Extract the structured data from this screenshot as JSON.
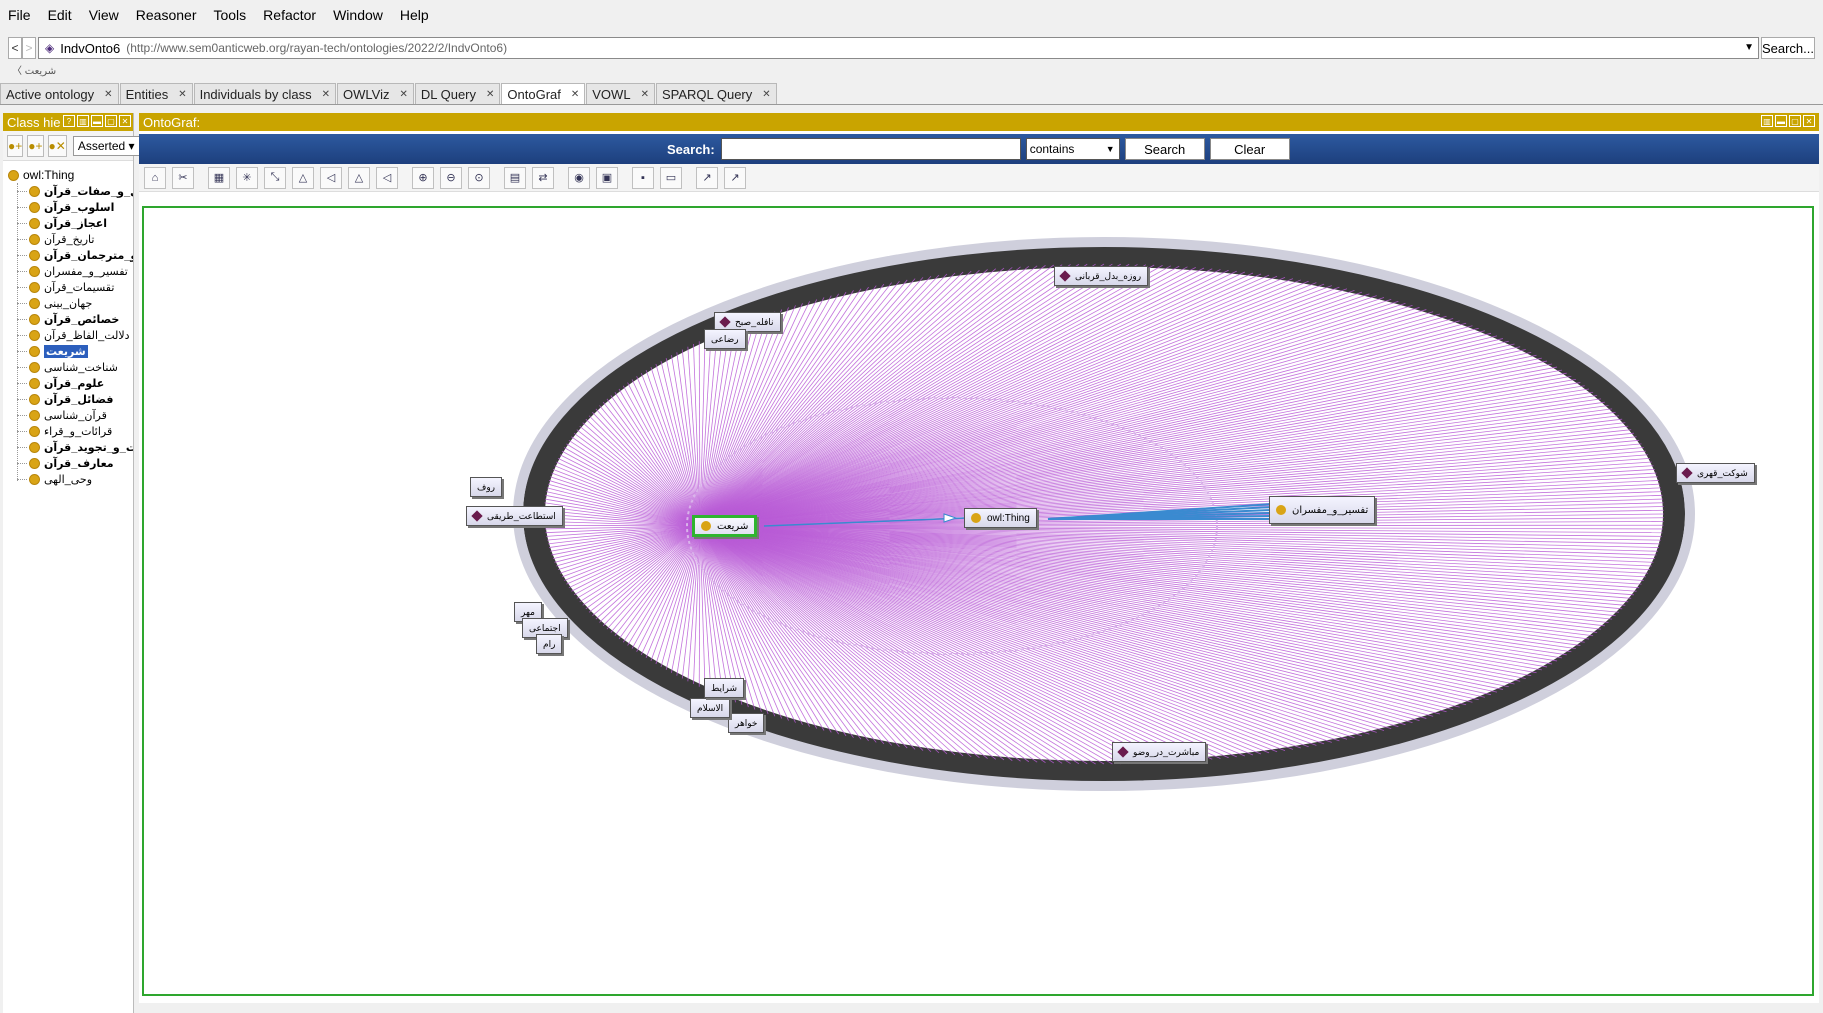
{
  "menu": [
    "File",
    "Edit",
    "View",
    "Reasoner",
    "Tools",
    "Refactor",
    "Window",
    "Help"
  ],
  "address": {
    "back": "<",
    "forward": ">",
    "ontology_name": "IndvOnto6",
    "iri": "(http://www.sem0anticweb.org/rayan-tech/ontologies/2022/2/IndvOnto6)",
    "search_button": "Search..."
  },
  "breadcrumb": "شریعت",
  "tabs": [
    {
      "label": "Active ontology",
      "active": false
    },
    {
      "label": "Entities",
      "active": false
    },
    {
      "label": "Individuals by class",
      "active": false
    },
    {
      "label": "OWLViz",
      "active": false
    },
    {
      "label": "DL Query",
      "active": false
    },
    {
      "label": "OntoGraf",
      "active": true
    },
    {
      "label": "VOWL",
      "active": false
    },
    {
      "label": "SPARQL Query",
      "active": false
    }
  ],
  "class_panel": {
    "title": "Class hie",
    "mode": "Asserted",
    "root": "owl:Thing",
    "items": [
      {
        "label": "اسامی_و_صفات_قرآن",
        "bold": true
      },
      {
        "label": "اسلوب_قرآن",
        "bold": true
      },
      {
        "label": "اعجاز_قرآن",
        "bold": true
      },
      {
        "label": "تاریخ_قرآن",
        "bold": false
      },
      {
        "label": "ترجمه_و_مترجمان_قرآن",
        "bold": true
      },
      {
        "label": "تفسیر_و_مفسران",
        "bold": false
      },
      {
        "label": "تقسیمات_قرآن",
        "bold": false
      },
      {
        "label": "جهان_بینی",
        "bold": false
      },
      {
        "label": "خصائص_قرآن",
        "bold": true
      },
      {
        "label": "دلالت_الفاظ_قرآن",
        "bold": false
      },
      {
        "label": "شریعت",
        "bold": true,
        "selected": true
      },
      {
        "label": "شناخت_شناسی",
        "bold": false
      },
      {
        "label": "علوم_قرآن",
        "bold": true
      },
      {
        "label": "فضائل_قرآن",
        "bold": true
      },
      {
        "label": "قرآن_شناسی",
        "bold": false
      },
      {
        "label": "قرائات_و_قراء",
        "bold": false
      },
      {
        "label": "قرائت_و_تجوید_قرآن",
        "bold": true
      },
      {
        "label": "معارف_قرآن",
        "bold": true
      },
      {
        "label": "وحی_الهی",
        "bold": false
      }
    ]
  },
  "ontograf": {
    "title": "OntoGraf:",
    "search_label": "Search:",
    "search_value": "",
    "match_mode": "contains",
    "search_button": "Search",
    "clear_button": "Clear",
    "toolbar_icons": [
      "home-icon",
      "remove-icon",
      "grid-layout-icon",
      "radial-layout-icon",
      "spring-layout-icon",
      "tree-vertical-icon",
      "tree-horizontal-icon",
      "vertical-directed-icon",
      "horizontal-directed-icon",
      "zoom-in-icon",
      "zoom-out-icon",
      "zoom-fit-icon",
      "filter-nodes-icon",
      "filter-arcs-icon",
      "snapshot-icon",
      "export-image-icon",
      "save-icon",
      "open-icon",
      "export-dot-icon",
      "export-image2-icon"
    ],
    "colors": {
      "individual_arc": "#b85ad6",
      "subclass_arc": "#3a8ad0",
      "focus_border": "#2fb52f",
      "class_dot": "#d9a416",
      "individual_diamond": "#6a1b4d"
    },
    "focus_node": "شریعت",
    "root_node": "owl:Thing",
    "sibling_node": "تفسیر_و_مفسران",
    "visible_individuals": [
      "روزه_بدل_قربانی",
      "نافله_صبح",
      "رضاعی",
      "شوکت_قهری",
      "استطاعت_طریقی",
      "مباشرت_در_وضو",
      "روف",
      "مهر",
      "اجتماعی",
      "رام",
      "خواهر",
      "الاسلام",
      "شرایط"
    ]
  }
}
